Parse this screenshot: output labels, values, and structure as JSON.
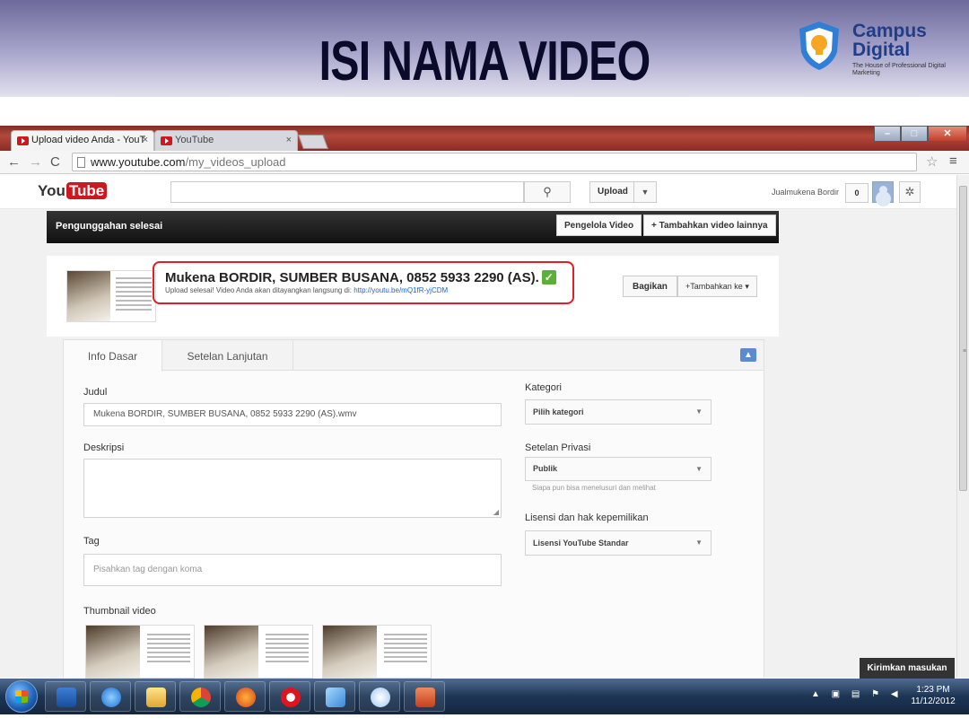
{
  "slide": {
    "title": "ISI NAMA VIDEO",
    "brand": {
      "name_line1": "Campus",
      "name_line2": "Digital",
      "tagline": "The House of Professional Digital Marketing"
    }
  },
  "browser": {
    "tabs": [
      {
        "label": "Upload video Anda - YouT",
        "active": true
      },
      {
        "label": "YouTube",
        "active": false
      }
    ],
    "url_host": "www.youtube.com",
    "url_path": "/my_videos_upload"
  },
  "youtube": {
    "logo_you": "You",
    "logo_tube": "Tube",
    "search_placeholder": "",
    "upload_label": "Upload",
    "user_name": "Jualmukena Bordir",
    "notification_count": "0",
    "upload_bar": {
      "title": "Pengunggahan selesai",
      "manager_button": "Pengelola Video",
      "add_more_button": "+ Tambahkan video lainnya"
    },
    "video": {
      "title": "Mukena BORDIR, SUMBER BUSANA, 0852 5933 2290 (AS).",
      "status_text": "Upload selesai! Video Anda akan ditayangkan langsung di: ",
      "link": "http://youtu.be/mQ1fR-yjCDM",
      "share_button": "Bagikan",
      "add_to_button": "+Tambahkan ke"
    },
    "form": {
      "tabs": [
        "Info Dasar",
        "Setelan Lanjutan"
      ],
      "title_label": "Judul",
      "title_value": "Mukena BORDIR, SUMBER BUSANA, 0852 5933 2290 (AS).wmv",
      "description_label": "Deskripsi",
      "description_value": "",
      "tag_label": "Tag",
      "tag_placeholder": "Pisahkan tag dengan koma",
      "thumbnail_label": "Thumbnail video",
      "category_label": "Kategori",
      "category_value": "Pilih kategori",
      "privacy_label": "Setelan Privasi",
      "privacy_value": "Publik",
      "privacy_hint": "Siapa pun bisa menelusuri dan melihat",
      "license_label": "Lisensi dan hak kepemilikan",
      "license_value": "Lisensi YouTube Standar"
    },
    "feedback_button": "Kirimkan masukan"
  },
  "taskbar": {
    "time": "1:23 PM",
    "date": "11/12/2012"
  }
}
